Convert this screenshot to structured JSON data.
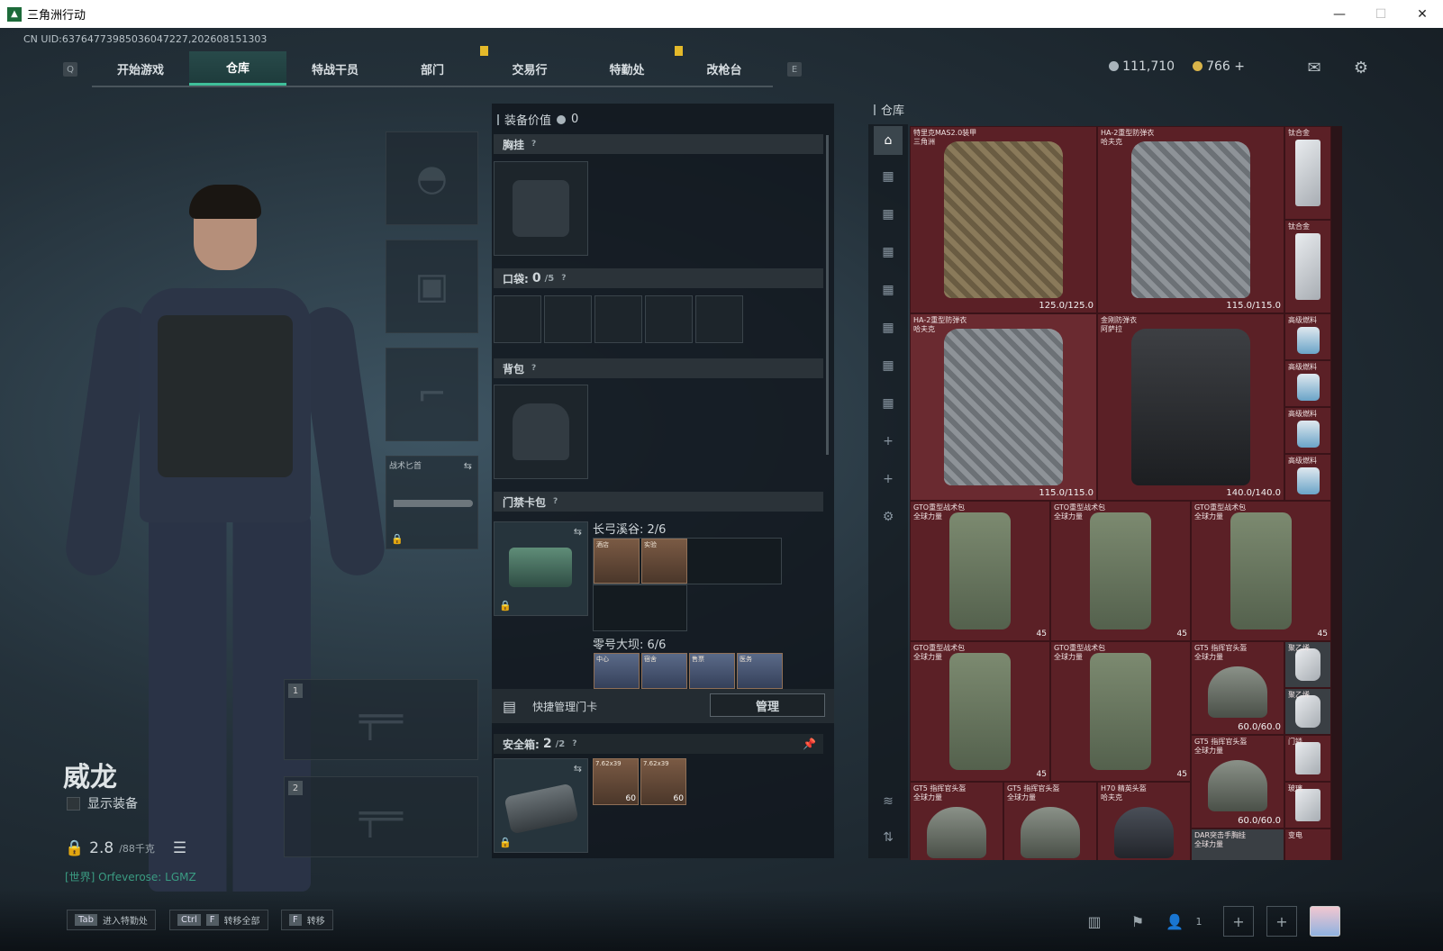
{
  "window": {
    "title": "三角洲行动",
    "min": "—",
    "max": "☐",
    "close": "✕"
  },
  "uid": "CN UID:637647739850360472​27,202608151303",
  "nav": {
    "key_left": "Q",
    "key_right": "E",
    "tabs": [
      "开始游戏",
      "仓库",
      "特战干员",
      "部门",
      "交易行",
      "特勤处",
      "改枪台"
    ]
  },
  "currency": {
    "silver": "111,710",
    "gold": "766",
    "plus": "+",
    "silver_color": "#a9b4bb",
    "gold_color": "#d9b44a"
  },
  "character": {
    "name": "威龙",
    "show_equip": "显示装备",
    "weight": "2.8",
    "weight_max": "/88千克",
    "world": "[世界] Orfeverose: LGMZ"
  },
  "left_slots": {
    "knife_label": "战术匕首",
    "weapon1_num": "1",
    "weapon2_num": "2"
  },
  "equip": {
    "value_label": "装备价值",
    "value": "0",
    "chest": "胸挂",
    "pockets": "口袋:",
    "pockets_val": "0",
    "pockets_max": "/5",
    "backpack": "背包",
    "keycard": "门禁卡包",
    "map1": "长弓溪谷: 2/6",
    "map2": "零号大坝: 6/6",
    "cards1": [
      "酒店",
      "实验"
    ],
    "cards2": [
      "中心",
      "宿舍",
      "售票",
      "医务"
    ],
    "manage_label": "快捷管理门卡",
    "manage_btn": "管理",
    "safe_label": "安全箱:",
    "safe_val": "2",
    "safe_max": "/2",
    "ammo": [
      {
        "name": "7.62x39",
        "count": "60"
      },
      {
        "name": "7.62x39",
        "count": "60"
      }
    ]
  },
  "warehouse": {
    "title": "仓库",
    "items": {
      "armor1_name": "特里克MAS2.0装甲",
      "armor1_sub": "三角洲",
      "armor1_dur": "125.0/125.0",
      "armor2_name": "HA-2重型防弹衣",
      "armor2_sub": "哈夫克",
      "armor2_dur": "115.0/115.0",
      "armor3_name": "HA-2重型防弹衣",
      "armor3_sub": "哈夫克",
      "armor3_dur": "115.0/115.0",
      "armor4_name": "金刚防弹衣",
      "armor4_sub": "阿萨拉",
      "armor4_dur": "140.0/140.0",
      "plate": "钛合金",
      "fuel": "高级燃料",
      "bag_name": "GTO重型战术包",
      "bag_sub": "全球力量",
      "bag_cnt": "45",
      "helm_name": "GT5 指挥官头盔",
      "helm_sub": "全球力量",
      "helm_dur": "60.0/60.0",
      "h70_name": "H70 精英头盔",
      "h70_sub": "哈夫克",
      "dar_name": "DAR突击手胸挂",
      "dar_sub": "全球力量",
      "misc1": "聚乙烯",
      "misc2": "门锁",
      "misc3": "玻璃",
      "misc4": "变电"
    }
  },
  "bottom": {
    "hint1_key": "Tab",
    "hint1": "进入特勤处",
    "hint2_key1": "Ctrl",
    "hint2_key2": "F",
    "hint2": "转移全部",
    "hint3_key": "F",
    "hint3": "转移",
    "players": "1"
  }
}
